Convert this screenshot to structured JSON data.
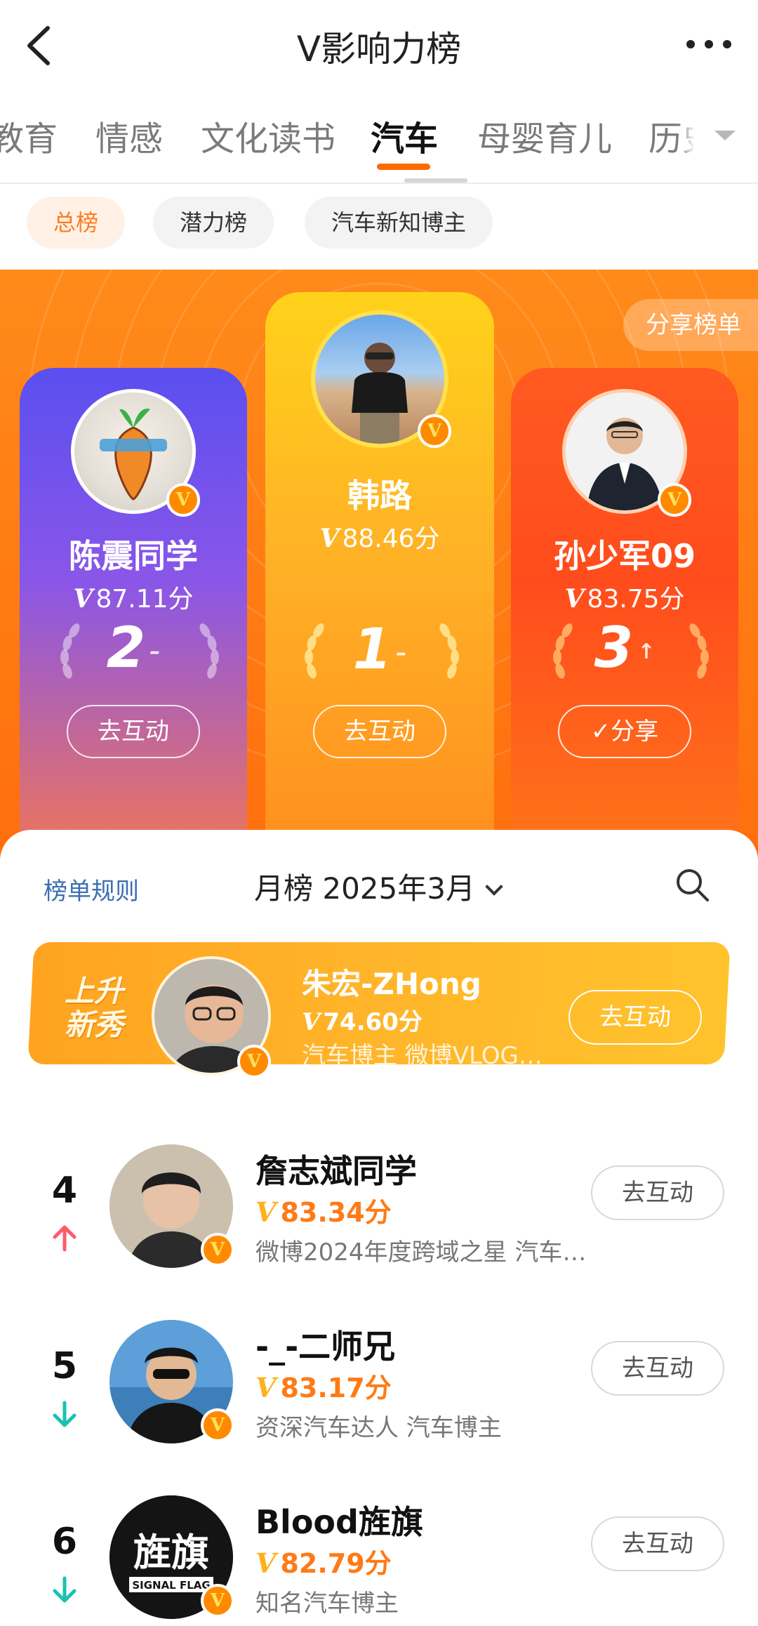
{
  "header": {
    "title": "V影响力榜"
  },
  "categories": [
    {
      "label": "教育"
    },
    {
      "label": "情感"
    },
    {
      "label": "文化读书"
    },
    {
      "label": "汽车",
      "active": true
    },
    {
      "label": "母婴育儿"
    },
    {
      "label": "历史"
    }
  ],
  "sub_tabs": [
    {
      "label": "总榜",
      "active": true
    },
    {
      "label": "潜力榜"
    },
    {
      "label": "汽车新知博主"
    }
  ],
  "podium": {
    "share_label": "分享榜单",
    "first": {
      "name": "韩路",
      "score": "88.46分",
      "rank": "1",
      "trend": "–",
      "button": "去互动"
    },
    "second": {
      "name": "陈震同学",
      "score": "87.11分",
      "rank": "2",
      "trend": "–",
      "button": "去互动"
    },
    "third": {
      "name": "孙少军09",
      "score": "83.75分",
      "rank": "3",
      "trend": "↑",
      "button": "✓分享"
    }
  },
  "list": {
    "rules_label": "榜单规则",
    "period_label": "月榜 2025年3月",
    "rising": {
      "tag_line1": "上升",
      "tag_line2": "新秀",
      "name": "朱宏-ZHong",
      "score": "74.60分",
      "desc": "汽车博主 微博VLOG…",
      "button": "去互动"
    },
    "rows": [
      {
        "rank": "4",
        "trend": "up",
        "name": "詹志斌同学",
        "score": "83.34分",
        "desc": "微博2024年度跨域之星 汽车…",
        "button": "去互动"
      },
      {
        "rank": "5",
        "trend": "down",
        "name": "-_-二师兄",
        "score": "83.17分",
        "desc": "资深汽车达人 汽车博主",
        "button": "去互动"
      },
      {
        "rank": "6",
        "trend": "down",
        "name": "Blood旌旗",
        "score": "82.79分",
        "desc": "知名汽车博主",
        "button": "去互动"
      }
    ]
  },
  "icons": {
    "v_mark": "V",
    "avatar_logo_text": "旌旗",
    "avatar_logo_subtext": "SIGNAL FLAG"
  },
  "colors": {
    "accent": "#ff6a00",
    "score_orange": "#ff7a16",
    "trend_up": "#ff5a6a",
    "trend_down": "#19c2b0",
    "link_blue": "#3a6fb0"
  }
}
